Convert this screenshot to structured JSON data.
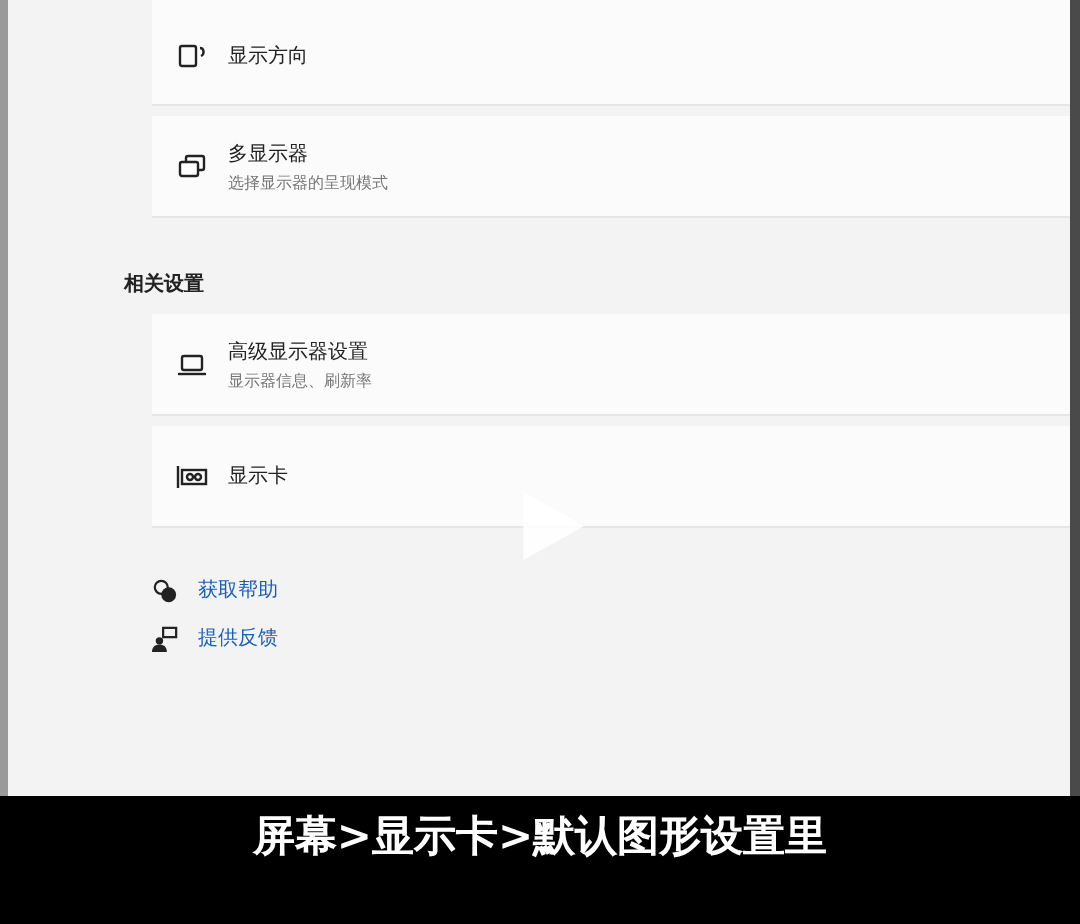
{
  "cards_top": [
    {
      "title": "显示方向"
    },
    {
      "title": "多显示器",
      "subtitle": "选择显示器的呈现模式"
    }
  ],
  "related": {
    "heading": "相关设置",
    "cards": [
      {
        "title": "高级显示器设置",
        "subtitle": "显示器信息、刷新率"
      },
      {
        "title": "显示卡"
      }
    ]
  },
  "links": [
    {
      "label": "获取帮助"
    },
    {
      "label": "提供反馈"
    }
  ],
  "caption": "屏幕>显示卡>默认图形设置里"
}
